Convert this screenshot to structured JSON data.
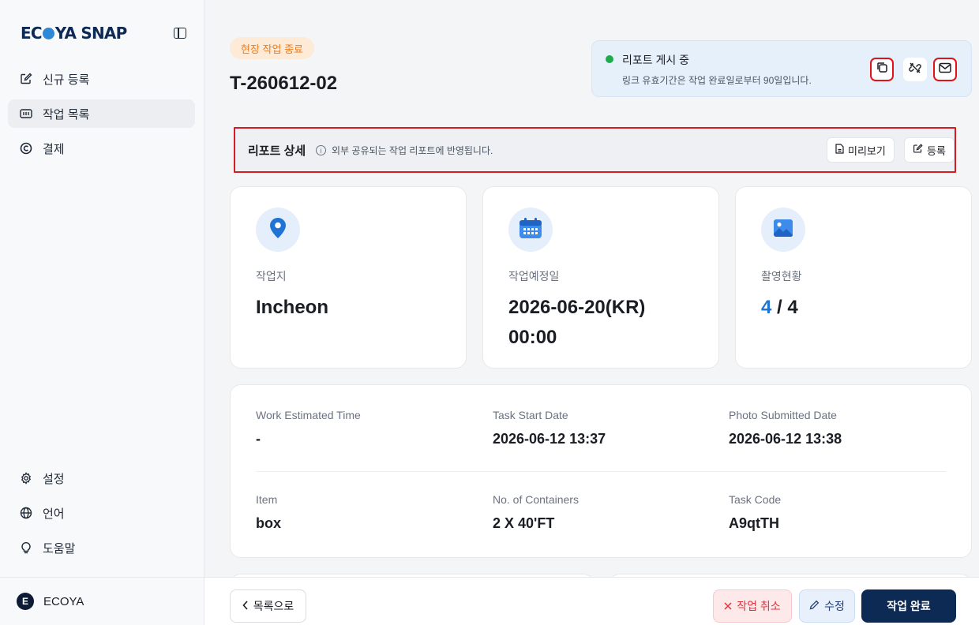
{
  "app": {
    "logo_text_1": "EC",
    "logo_text_2": "YA SNAP"
  },
  "sidebar": {
    "items": [
      {
        "label": "신규 등록",
        "icon": "edit-square-icon",
        "active": false
      },
      {
        "label": "작업 목록",
        "icon": "list-box-icon",
        "active": true
      },
      {
        "label": "결제",
        "icon": "copyright-circle-icon",
        "active": false
      }
    ],
    "bottom_items": [
      {
        "label": "설정",
        "icon": "gear-icon"
      },
      {
        "label": "언어",
        "icon": "globe-icon"
      },
      {
        "label": "도움말",
        "icon": "lightbulb-icon"
      }
    ],
    "user": {
      "initial": "E",
      "name": "ECOYA"
    }
  },
  "header": {
    "status": "현장 작업 종료",
    "task_id": "T-260612-02",
    "publish": {
      "title": "리포트 게시 중",
      "description": "링크 유효기간은 작업 완료일로부터 90일입니다.",
      "status_color": "#1eab4c"
    }
  },
  "report_detail": {
    "title": "리포트 상세",
    "info": "외부 공유되는 작업 리포트에 반영됩니다.",
    "preview_label": "미리보기",
    "register_label": "등록"
  },
  "cards": {
    "location": {
      "label": "작업지",
      "value": "Incheon",
      "icon": "map-pin-icon"
    },
    "schedule": {
      "label": "작업예정일",
      "value_line1": "2026-06-20(KR)",
      "value_line2": "00:00",
      "icon": "calendar-icon"
    },
    "photos": {
      "label": "촬영현황",
      "taken": "4",
      "separator": " / ",
      "total": "4",
      "icon": "image-icon"
    }
  },
  "details": {
    "work_estimated_time": {
      "label": "Work Estimated Time",
      "value": "-"
    },
    "task_start_date": {
      "label": "Task Start Date",
      "value": "2026-06-12 13:37"
    },
    "photo_submitted_date": {
      "label": "Photo Submitted Date",
      "value": "2026-06-12 13:38"
    },
    "item": {
      "label": "Item",
      "value": "box"
    },
    "containers": {
      "label": "No. of Containers",
      "value": "2 X 40'FT"
    },
    "task_code": {
      "label": "Task Code",
      "value": "A9qtTH"
    }
  },
  "footer": {
    "back_label": "목록으로",
    "cancel_label": "작업 취소",
    "edit_label": "수정",
    "complete_label": "작업 완료"
  },
  "colors": {
    "brand_navy": "#0d2a55",
    "accent_blue": "#1f74d6",
    "status_orange": "#ef7a1a",
    "danger_red": "#e0313d",
    "highlight_red": "#e0131b"
  }
}
